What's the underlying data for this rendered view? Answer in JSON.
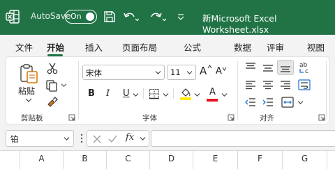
{
  "titlebar": {
    "autosave_label": "AutoSave",
    "autosave_state": "On",
    "doc_title": "新Microsoft Excel Worksheet.xlsx"
  },
  "tabs": [
    "文件",
    "开始",
    "插入",
    "页面布局",
    "公式",
    "数据",
    "评审",
    "视图"
  ],
  "active_tab": "开始",
  "ribbon": {
    "clipboard": {
      "paste_label": "粘贴",
      "group_label": "剪贴板"
    },
    "font": {
      "font_name": "宋体",
      "font_size": "11",
      "bold": "B",
      "italic": "I",
      "underline": "U",
      "font_color_letter": "A",
      "grow_letter": "A",
      "shrink_letter": "A",
      "group_label": "字体"
    },
    "alignment": {
      "group_label": "对齐",
      "wrap_text": "ab c"
    }
  },
  "formula_bar": {
    "name_box": "铂",
    "fx_label": "fx"
  },
  "columns": [
    "A",
    "B",
    "C",
    "D",
    "E",
    "F",
    "G"
  ],
  "colors": {
    "accent": "#217346",
    "fill_highlight": "#ffeb00",
    "font_red": "#e81123"
  }
}
